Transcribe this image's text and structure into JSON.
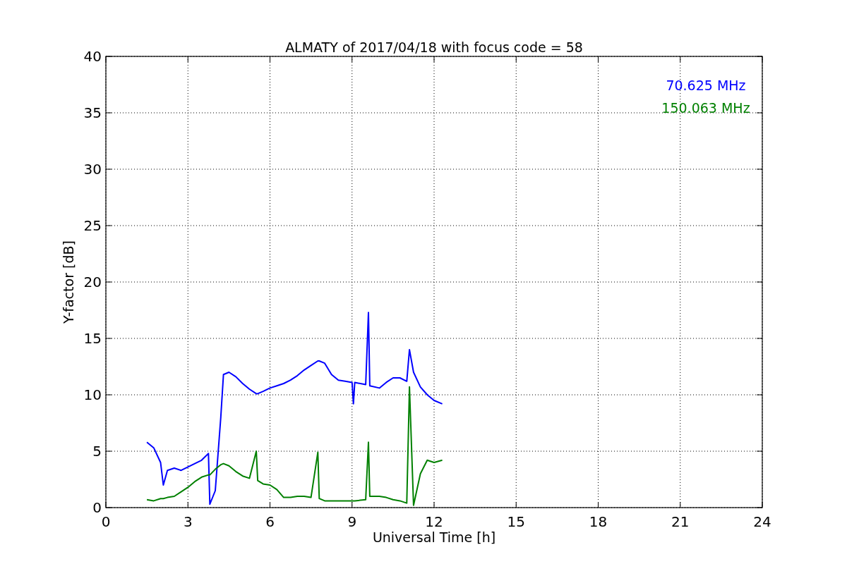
{
  "chart_data": {
    "type": "line",
    "title": "ALMATY of 2017/04/18 with focus code = 58",
    "xlabel": "Universal Time [h]",
    "ylabel": "Y-factor [dB]",
    "x": [
      1.5,
      1.75,
      2.0,
      2.1,
      2.25,
      2.5,
      2.75,
      3.0,
      3.25,
      3.5,
      3.75,
      3.8,
      4.0,
      4.2,
      4.3,
      4.5,
      4.75,
      5.0,
      5.25,
      5.5,
      5.55,
      5.75,
      6.0,
      6.25,
      6.5,
      6.75,
      7.0,
      7.25,
      7.5,
      7.75,
      7.8,
      8.0,
      8.25,
      8.5,
      8.75,
      9.0,
      9.05,
      9.1,
      9.5,
      9.6,
      9.65,
      10.0,
      10.25,
      10.5,
      10.75,
      11.0,
      11.1,
      11.25,
      11.5,
      11.75,
      12.0,
      12.3
    ],
    "series": [
      {
        "name": "70.625 MHz",
        "color": "#0000ff",
        "values": [
          5.8,
          5.3,
          4.0,
          2.0,
          3.3,
          3.5,
          3.3,
          3.6,
          3.9,
          4.2,
          4.8,
          0.3,
          1.5,
          8.0,
          11.8,
          12.0,
          11.6,
          11.0,
          10.5,
          10.1,
          10.1,
          10.3,
          10.6,
          10.8,
          11.0,
          11.3,
          11.7,
          12.2,
          12.6,
          13.0,
          13.0,
          12.8,
          11.8,
          11.3,
          11.2,
          11.1,
          9.2,
          11.1,
          10.9,
          17.3,
          10.8,
          10.6,
          11.1,
          11.5,
          11.5,
          11.2,
          14.0,
          12.0,
          10.7,
          10.0,
          9.5,
          9.2
        ]
      },
      {
        "name": "150.063 MHz",
        "color": "#008000",
        "values": [
          0.7,
          0.6,
          0.8,
          0.8,
          0.9,
          1.0,
          1.4,
          1.8,
          2.3,
          2.7,
          2.9,
          2.9,
          3.4,
          3.8,
          3.9,
          3.7,
          3.2,
          2.8,
          2.6,
          5.0,
          2.4,
          2.1,
          2.0,
          1.6,
          0.9,
          0.9,
          1.0,
          1.0,
          0.9,
          4.9,
          0.8,
          0.6,
          0.6,
          0.6,
          0.6,
          0.6,
          0.6,
          0.6,
          0.7,
          5.8,
          1.0,
          1.0,
          0.9,
          0.7,
          0.6,
          0.4,
          10.7,
          0.2,
          3.0,
          4.2,
          4.0,
          4.2
        ]
      }
    ],
    "grid": true,
    "xlim": [
      0,
      24
    ],
    "ylim": [
      0,
      40
    ],
    "xticks": [
      0,
      3,
      6,
      9,
      12,
      15,
      18,
      21,
      24
    ],
    "yticks": [
      0,
      5,
      10,
      15,
      20,
      25,
      30,
      35,
      40
    ]
  }
}
